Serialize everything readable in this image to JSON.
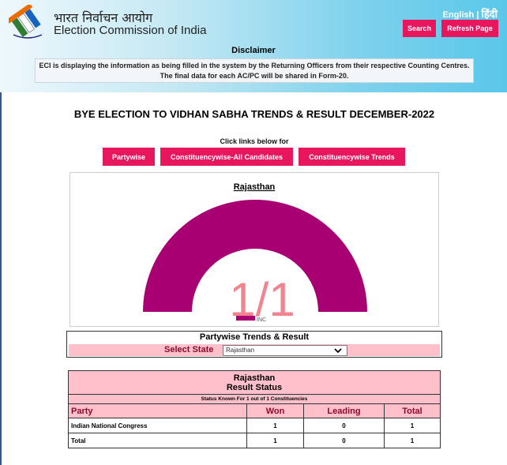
{
  "header": {
    "hindi_title": "भारत निर्वाचन आयोग",
    "english_title": "Election Commission of India",
    "lang_english": "English",
    "lang_separator": "|",
    "lang_hindi": "हिंदी",
    "search_label": "Search",
    "refresh_label": "Refresh Page",
    "disclaimer_title": "Disclaimer",
    "disclaimer_line1": "ECI is displaying the information as being filled in the system by the Returning Officers from their respective Counting Centres.",
    "disclaimer_line2": "The final data for each AC/PC will be shared in Form-20."
  },
  "main": {
    "page_title": "BYE ELECTION TO VIDHAN SABHA TRENDS & RESULT DECEMBER-2022",
    "click_text": "Click links below for",
    "links": [
      "Partywise",
      "Constituencywise-All Candidates",
      "Constituencywise Trends"
    ]
  },
  "chart_data": {
    "type": "pie",
    "title": "Rajasthan",
    "center_label": "1/1",
    "slices": [
      {
        "name": "INC",
        "value": 1,
        "color": "#a80073"
      }
    ],
    "total": 1
  },
  "partywise": {
    "title": "Partywise Trends & Result",
    "select_label": "Select State",
    "selected_state": "Rajasthan"
  },
  "result_table": {
    "state": "Rajasthan",
    "heading": "Result Status",
    "status_known": "Status Known For 1 out of 1 Constituencies",
    "columns": [
      "Party",
      "Won",
      "Leading",
      "Total"
    ],
    "rows": [
      {
        "party": "Indian National Congress",
        "won": "1",
        "leading": "0",
        "total": "1"
      },
      {
        "party": "Total",
        "won": "1",
        "leading": "0",
        "total": "1"
      }
    ]
  },
  "colors": {
    "accent": "#e8165d",
    "chart": "#a80073",
    "table_header": "#ffc0cb",
    "label_red": "#8b0a2a"
  }
}
